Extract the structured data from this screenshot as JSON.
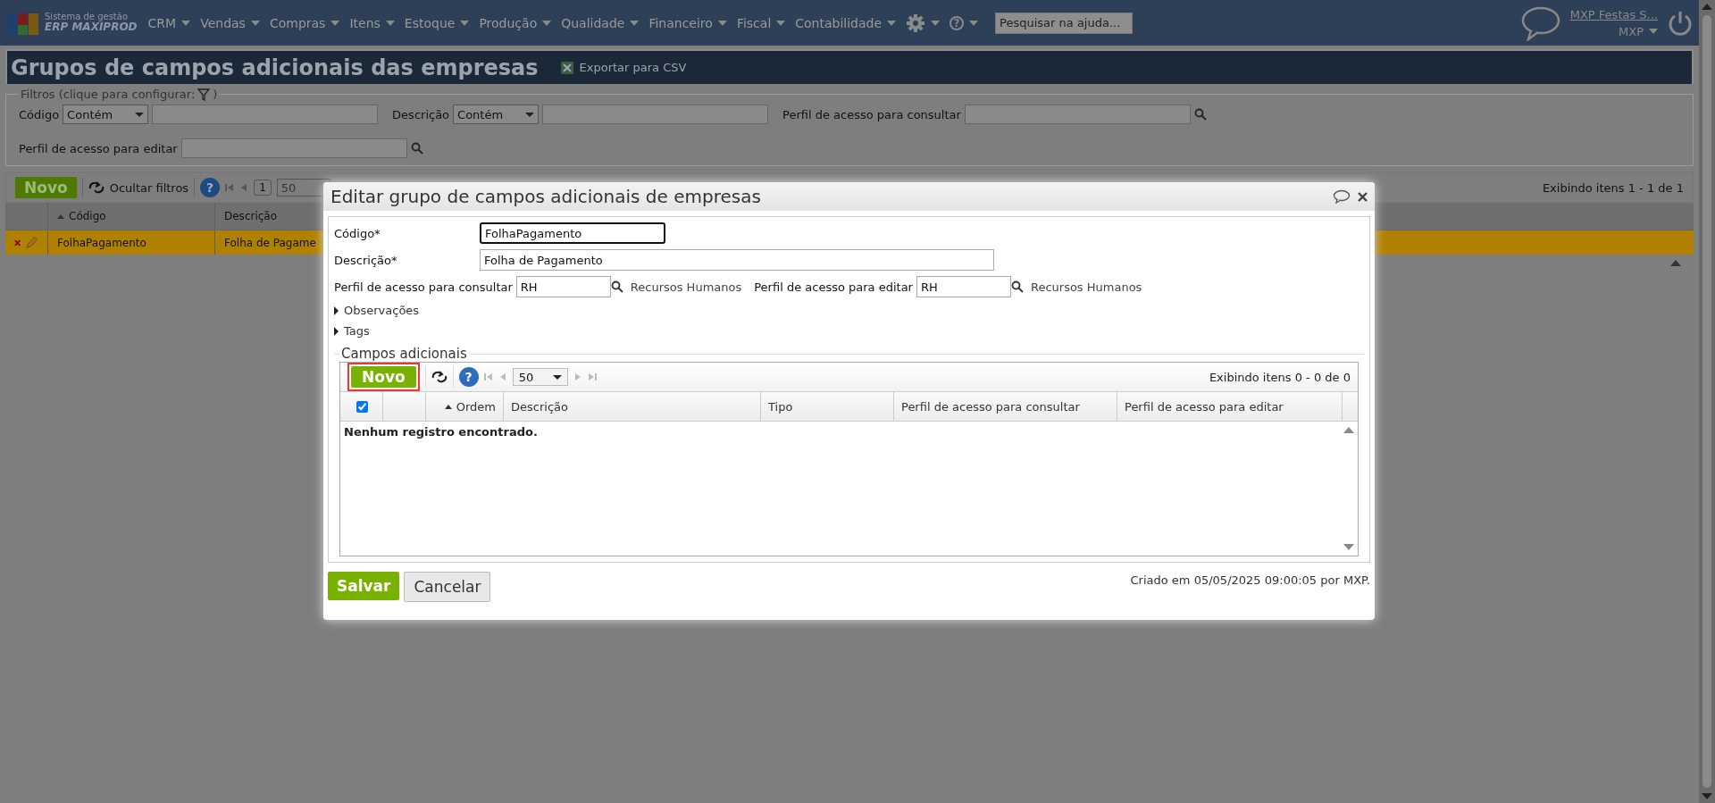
{
  "app": {
    "logo_line1": "Sistema de gestão",
    "logo_line2": "ERP MAXIPROD"
  },
  "menu": [
    {
      "label": "CRM"
    },
    {
      "label": "Vendas"
    },
    {
      "label": "Compras"
    },
    {
      "label": "Itens"
    },
    {
      "label": "Estoque"
    },
    {
      "label": "Produção"
    },
    {
      "label": "Qualidade"
    },
    {
      "label": "Financeiro"
    },
    {
      "label": "Fiscal"
    },
    {
      "label": "Contabilidade"
    }
  ],
  "menu_help_icon": "?",
  "help_search": {
    "placeholder": "Pesquisar na ajuda..."
  },
  "user": {
    "company": "MXP Festas S...",
    "user": "MXP"
  },
  "page": {
    "title": "Grupos de campos adicionais das empresas",
    "export": "Exportar para CSV"
  },
  "filters": {
    "legend": "Filtros (clique para configurar:",
    "legend_end": ")",
    "fields": [
      {
        "kind": "select",
        "label": "Código",
        "operator": "Contém"
      },
      {
        "kind": "select",
        "label": "Descrição",
        "operator": "Contém"
      },
      {
        "kind": "lookup",
        "label": "Perfil de acesso para consultar"
      },
      {
        "kind": "lookup",
        "label": "Perfil de acesso para editar"
      }
    ]
  },
  "toolbar": {
    "new": "Novo",
    "hide_filters": "Ocultar filtros",
    "help_icon": "?",
    "page": "1",
    "page_size": "50",
    "status": "Exibindo itens 1 - 1 de 1"
  },
  "table": {
    "columns": [
      {
        "label": "Código",
        "sorted": true
      },
      {
        "label": "Descrição",
        "sorted": false
      }
    ],
    "rows": [
      {
        "codigo": "FolhaPagamento",
        "descricao": "Folha de Pagame",
        "selected": true
      }
    ]
  },
  "dialog": {
    "title": "Editar grupo de campos adicionais de empresas",
    "code": {
      "label": "Código*",
      "value": "FolhaPagamento",
      "focused": true
    },
    "description": {
      "label": "Descrição*",
      "value": "Folha de Pagamento"
    },
    "profiles": [
      {
        "label": "Perfil de acesso para consultar",
        "value": "RH",
        "name": "Recursos Humanos"
      },
      {
        "label": "Perfil de acesso para editar",
        "value": "RH",
        "name": "Recursos Humanos"
      }
    ],
    "sections": [
      {
        "label": "Observações",
        "expanded": false
      },
      {
        "label": "Tags",
        "expanded": false
      }
    ],
    "grid": {
      "legend": "Campos adicionais",
      "new": "Novo",
      "new_highlighted": true,
      "help_icon": "?",
      "page_size": "50",
      "status": "Exibindo itens 0 - 0 de 0",
      "select_all": {
        "checked": true
      },
      "columns": [
        {
          "label": "Ordem",
          "sorted": true
        },
        {
          "label": "Descrição",
          "sorted": false
        },
        {
          "label": "Tipo",
          "sorted": false
        },
        {
          "label": "Perfil de acesso para consultar",
          "sorted": false
        },
        {
          "label": "Perfil de acesso para editar",
          "sorted": false
        }
      ],
      "empty": "Nenhum registro encontrado."
    },
    "buttons": [
      {
        "label": "Salvar",
        "kind": "primary"
      },
      {
        "label": "Cancelar",
        "kind": "secondary"
      }
    ],
    "footer": "Criado em 05/05/2025 09:00:05 por MXP."
  }
}
